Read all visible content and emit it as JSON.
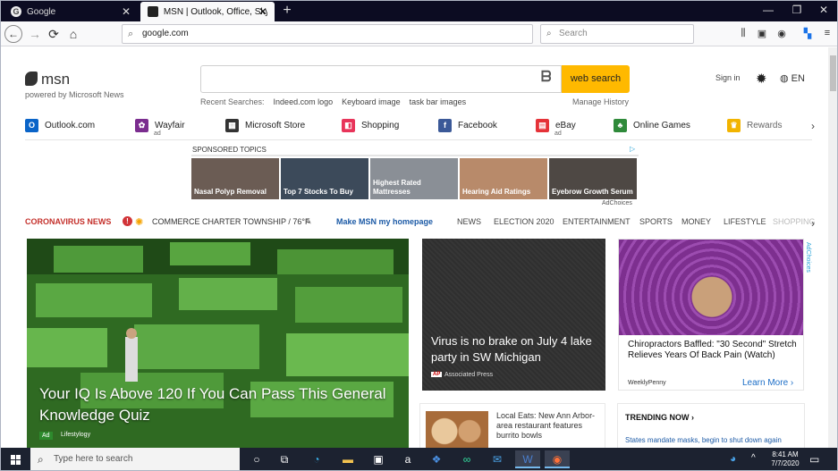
{
  "browser": {
    "tabs": [
      {
        "title": "Google",
        "icon": "google-favicon",
        "favicon_letter": "G",
        "close": "✕"
      },
      {
        "title": "MSN | Outlook, Office, Skype, B",
        "icon": "msn-favicon",
        "close": "✕"
      }
    ],
    "new_tab": "+",
    "window_controls": {
      "minimize": "—",
      "restore": "❐",
      "close": "✕"
    },
    "url": "google.com",
    "search_placeholder": "Search"
  },
  "msn": {
    "logo_text": "msn",
    "powered_by": "powered by Microsoft News",
    "search_button": "web search",
    "recent_label": "Recent Searches:",
    "recent_searches": [
      "Indeed.com logo",
      "Keyboard image",
      "task bar images"
    ],
    "manage_history": "Manage History",
    "sign_in": "Sign in",
    "language": "EN"
  },
  "quick_links": [
    {
      "label": "Outlook.com",
      "color": "#0a64c8",
      "glyph": "O",
      "ad": ""
    },
    {
      "label": "Wayfair",
      "color": "#7b2d8f",
      "glyph": "✿",
      "ad": "ad"
    },
    {
      "label": "Microsoft Store",
      "color": "#333333",
      "glyph": "▦",
      "ad": ""
    },
    {
      "label": "Shopping",
      "color": "#e8345a",
      "glyph": "◧",
      "ad": ""
    },
    {
      "label": "Facebook",
      "color": "#3b5998",
      "glyph": "f",
      "ad": ""
    },
    {
      "label": "eBay",
      "color": "#e53238",
      "glyph": "▤",
      "ad": "ad"
    },
    {
      "label": "Online Games",
      "color": "#2f8a3a",
      "glyph": "♣",
      "ad": ""
    },
    {
      "label": "Rewards",
      "color": "#f2b400",
      "glyph": "♛",
      "ad": ""
    }
  ],
  "sponsored": {
    "label": "SPONSORED TOPICS",
    "ad_marker": "▷",
    "items": [
      {
        "label": "Nasal Polyp Removal",
        "color": "#6b5c54"
      },
      {
        "label": "Top 7 Stocks To Buy",
        "color": "#3c4a5a"
      },
      {
        "label": "Highest Rated Mattresses",
        "color": "#8a8f96"
      },
      {
        "label": "Hearing Aid Ratings",
        "color": "#b88a6a"
      },
      {
        "label": "Eyebrow Growth Serum",
        "color": "#4e4844"
      }
    ],
    "adchoices": "AdChoices"
  },
  "news_nav": {
    "coronavirus": "CORONAVIRUS NEWS",
    "alert": "!",
    "location": "COMMERCE CHARTER TOWNSHIP / 76°F",
    "make_home": "Make MSN my homepage",
    "categories": [
      "NEWS",
      "ELECTION 2020",
      "ENTERTAINMENT",
      "SPORTS",
      "MONEY",
      "LIFESTYLE",
      "SHOPPING"
    ]
  },
  "hero": {
    "title": "Your IQ Is Above 120 If You Can Pass This General Knowledge Quiz",
    "ad_label": "Ad",
    "source": "Lifestylogy"
  },
  "card2": {
    "title": "Virus is no brake on July 4 lake party in SW Michigan",
    "badge": "AP",
    "source": "Associated Press"
  },
  "card3": {
    "title": "Chiropractors Baffled: \"30 Second\" Stretch Relieves Years Of Back Pain (Watch)",
    "source": "WeeklyPenny",
    "learn_more": "Learn More ›",
    "adchoices": "AdChoices"
  },
  "card4": {
    "title": "Local Eats: New Ann Arbor-area restaurant features burrito bowls"
  },
  "trending": {
    "heading": "TRENDING NOW ›",
    "item": "States mandate masks, begin to shut down again"
  },
  "taskbar": {
    "search_placeholder": "Type here to search",
    "apps": [
      "task-view",
      "cortana",
      "edge",
      "file-explorer",
      "store",
      "amazon",
      "dropbox",
      "tripadvisor",
      "mail",
      "word",
      "firefox"
    ],
    "time": "8:41 AM",
    "date": "7/7/2020"
  }
}
